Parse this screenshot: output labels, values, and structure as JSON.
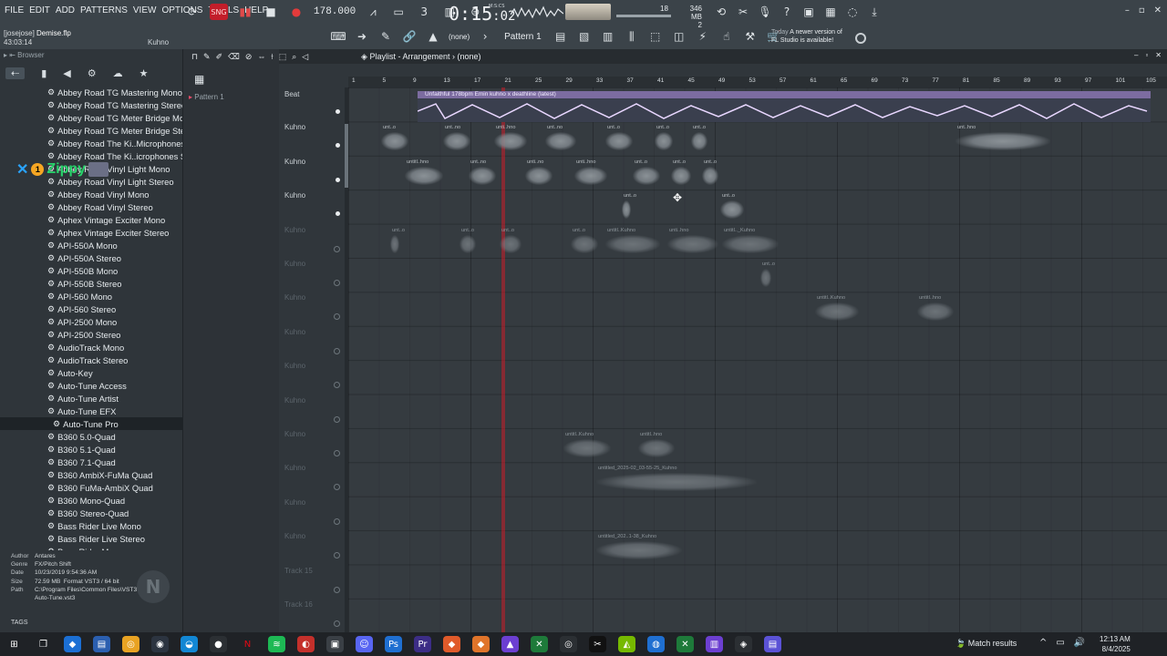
{
  "menu": [
    "FILE",
    "EDIT",
    "ADD",
    "PATTERNS",
    "VIEW",
    "OPTIONS",
    "TOOLS",
    "HELP"
  ],
  "file": {
    "user_project": "[josejose]",
    "project_name": "Demise.flp",
    "time": "43:03:14",
    "kuhno": "Kuhno"
  },
  "transport": {
    "tempo": "178.000",
    "time_main": "0:15",
    "time_sub": ":02",
    "time_label": "M:S:CS",
    "cpu_mem": "346 MB",
    "cpu_val": "18",
    "cpu_sub": "2"
  },
  "toolbar": {
    "pattern": "Pattern 1",
    "none": "(none)"
  },
  "notice": {
    "line1": "Today",
    "line2": "A newer version of",
    "line3": "FL Studio is available!"
  },
  "browser": {
    "title": "Browser",
    "plugins": [
      "Abbey Road TG Mastering Mono",
      "Abbey Road TG Mastering Stereo",
      "Abbey Road TG Meter Bridge Mono",
      "Abbey Road TG Meter Bridge Stereo",
      "Abbey Road The Ki..Microphones Mono",
      "Abbey Road The Ki..icrophones Stereo",
      "Abbey Road Vinyl Light Mono",
      "Abbey Road Vinyl Light Stereo",
      "Abbey Road Vinyl Mono",
      "Abbey Road Vinyl Stereo",
      "Aphex Vintage Exciter Mono",
      "Aphex Vintage Exciter Stereo",
      "API-550A Mono",
      "API-550A Stereo",
      "API-550B Mono",
      "API-550B Stereo",
      "API-560 Mono",
      "API-560 Stereo",
      "API-2500 Mono",
      "API-2500 Stereo",
      "AudioTrack Mono",
      "AudioTrack Stereo",
      "Auto-Key",
      "Auto-Tune Access",
      "Auto-Tune Artist",
      "Auto-Tune EFX",
      "Auto-Tune Pro",
      "B360 5.0-Quad",
      "B360 5.1-Quad",
      "B360 7.1-Quad",
      "B360 AmbiX-FuMa Quad",
      "B360 FuMa-AmbiX Quad",
      "B360 Mono-Quad",
      "B360 Stereo-Quad",
      "Bass Rider Live Mono",
      "Bass Rider Live Stereo",
      "Bass Rider Mono"
    ],
    "selected_index": 26,
    "zippy_label": "Zippy",
    "info": {
      "author_k": "Author",
      "author": "Antares",
      "genre_k": "Genre",
      "genre": "FX/Pitch Shift",
      "date_k": "Date",
      "date": "10/23/2019 9:54:36 AM",
      "size_k": "Size",
      "size": "72.59 MB",
      "format_k": "Format",
      "format": "VST3 / 64 bit",
      "path_k": "Path",
      "path1": "C:\\Program Files\\Common Files\\VST3\\Antares\\",
      "path2": "Auto-Tune.vst3"
    },
    "tags": "TAGS"
  },
  "patcol": {
    "pattern": "Pattern 1"
  },
  "playlist": {
    "title": "Playlist - Arrangement",
    "none": "(none)",
    "ruler": [
      "1",
      "5",
      "9",
      "13",
      "17",
      "21",
      "25",
      "29",
      "33",
      "37",
      "41",
      "45",
      "49",
      "53",
      "57",
      "61",
      "65",
      "69",
      "73",
      "77",
      "81",
      "85",
      "89",
      "93",
      "97",
      "101",
      "105"
    ],
    "tracks": [
      "Beat",
      "Kuhno",
      "Kuhno",
      "Kuhno",
      "Kuhno",
      "Kuhno",
      "Kuhno",
      "Kuhno",
      "Kuhno",
      "Kuhno",
      "Kuhno",
      "Kuhno",
      "Kuhno",
      "Kuhno",
      "Track 15",
      "Track 16"
    ],
    "master_clip": "Unfaithful 178bpm Emin kuhno x deathline (latest)",
    "clip_labels": {
      "a": "unt..o",
      "b": "unt..no",
      "c": "unti..hno",
      "d": "untitl..hno",
      "e": "unti..no",
      "f": "untitl..Kuhno",
      "g": "untitled_2025-02_03-55-25_Kuhno",
      "h": "untitle.._Kuhno",
      "i": "untitled_202..1-38_Kuhno",
      "j": "untitl.._Kuhno",
      "k": "unti..hno",
      "l": "untitl..hno",
      "m": "unt..hno"
    }
  },
  "taskbar": {
    "weather": "Match results",
    "time": "12:13 AM",
    "date": "8/4/2025"
  }
}
